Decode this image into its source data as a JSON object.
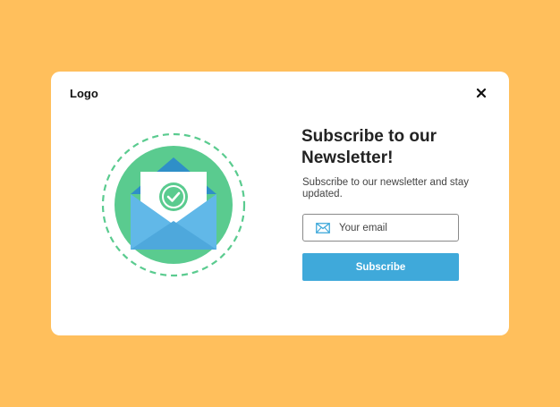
{
  "modal": {
    "logo_text": "Logo",
    "close_icon": "close-icon",
    "illustration_icon": "envelope-check-icon",
    "title": "Subscribe to our Newsletter!",
    "subtitle": "Subscribe to our newsletter and stay updated.",
    "email_field": {
      "icon": "mail-icon",
      "placeholder": "Your email",
      "value": ""
    },
    "subscribe_label": "Subscribe"
  },
  "colors": {
    "background": "#FFBF5C",
    "card": "#FFFFFF",
    "accent_blue": "#3FA9DA",
    "accent_green": "#5ACB8F"
  }
}
